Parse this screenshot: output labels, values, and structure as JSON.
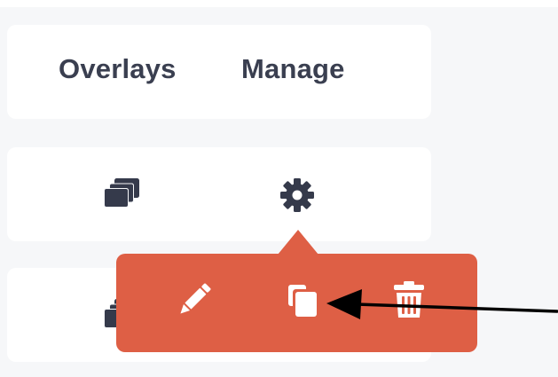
{
  "header": {
    "overlays_label": "Overlays",
    "manage_label": "Manage"
  },
  "rows": [
    {
      "overlay_icon": "layers-icon",
      "manage_icon": "gear-icon"
    },
    {
      "overlay_icon": "layers-icon",
      "manage_icon": "gear-icon"
    }
  ],
  "popover": {
    "actions": [
      {
        "icon": "pencil-icon",
        "action": "edit"
      },
      {
        "icon": "copy-icon",
        "action": "duplicate"
      },
      {
        "icon": "trash-icon",
        "action": "delete"
      }
    ]
  },
  "annotation": {
    "icon": "arrow-left-icon"
  },
  "colors": {
    "background": "#f6f7f9",
    "card": "#ffffff",
    "text": "#3a3f50",
    "icon": "#353a4b",
    "popover": "#de5f45",
    "popover_icon": "#ffffff",
    "arrow": "#000000"
  }
}
